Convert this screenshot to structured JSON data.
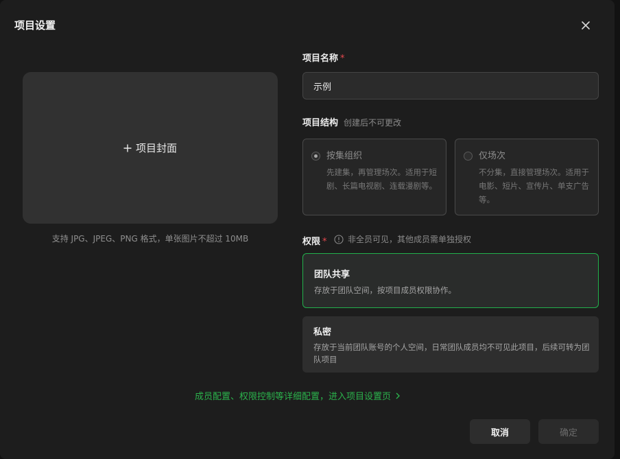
{
  "dialog": {
    "title": "项目设置",
    "close_icon": "close-icon"
  },
  "cover": {
    "label": "项目封面",
    "icon": "plus-icon",
    "hint": "支持 JPG、JPEG、PNG 格式，单张图片不超过 10MB"
  },
  "project_name": {
    "label": "项目名称",
    "required_mark": "*",
    "value": "示例"
  },
  "structure": {
    "label": "项目结构",
    "hint": "创建后不可更改",
    "options": [
      {
        "title": "按集组织",
        "description": "先建集，再管理场次。适用于短剧、长篇电视剧、连载漫剧等。",
        "checked": true
      },
      {
        "title": "仅场次",
        "description": "不分集，直接管理场次。适用于电影、短片、宣传片、单支广告等。",
        "checked": false
      }
    ]
  },
  "permission": {
    "label": "权限",
    "required_mark": "*",
    "info_icon": "info-icon",
    "hint": "非全员可见，其他成员需单独授权",
    "options": [
      {
        "title": "团队共享",
        "description": "存放于团队空间，按项目成员权限协作。",
        "selected": true
      },
      {
        "title": "私密",
        "description": "存放于当前团队账号的个人空间，日常团队成员均不可见此项目，后续可转为团队项目",
        "selected": false
      }
    ]
  },
  "settings_link": {
    "text": "成员配置、权限控制等详细配置，进入项目设置页",
    "icon": "chevron-right-icon"
  },
  "footer": {
    "cancel_label": "取消",
    "confirm_label": "确定"
  },
  "colors": {
    "accent_green": "#22b14c",
    "required_red": "#e5484d",
    "background": "#1d1d1d"
  }
}
